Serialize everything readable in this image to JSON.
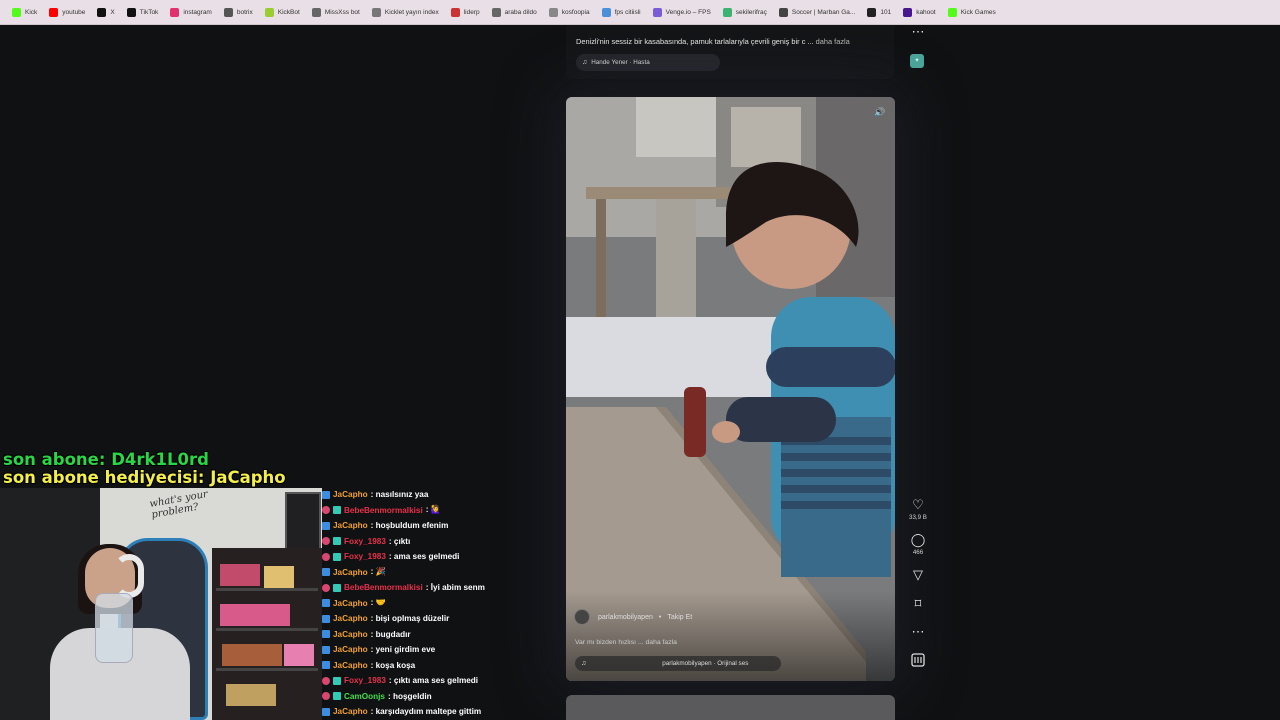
{
  "bookmarks": [
    {
      "label": "Kick",
      "color": "#53fc18"
    },
    {
      "label": "youtube",
      "color": "#ff0000"
    },
    {
      "label": "X",
      "color": "#111111"
    },
    {
      "label": "TikTok",
      "color": "#111111"
    },
    {
      "label": "instagram",
      "color": "#e1306c"
    },
    {
      "label": "botrix",
      "color": "#555555"
    },
    {
      "label": "KickBot",
      "color": "#9acd32"
    },
    {
      "label": "MissXss bot",
      "color": "#666666"
    },
    {
      "label": "Kicklet yayın index",
      "color": "#777777"
    },
    {
      "label": "liderp",
      "color": "#cc3333"
    },
    {
      "label": "araba dildo",
      "color": "#666666"
    },
    {
      "label": "kosfoopia",
      "color": "#888888"
    },
    {
      "label": "fps citiisli",
      "color": "#4a90d9"
    },
    {
      "label": "Venge.io – FPS",
      "color": "#7b5cd6"
    },
    {
      "label": "sekilerifraç",
      "color": "#3cb371"
    },
    {
      "label": "Soccer | Marban Ga...",
      "color": "#444444"
    },
    {
      "label": "101",
      "color": "#222222"
    },
    {
      "label": "kahoot",
      "color": "#46178f"
    },
    {
      "label": "Kick Games",
      "color": "#53fc18"
    }
  ],
  "previous_post": {
    "description": "Denizli'nin sessiz bir kasabasında, pamuk tarlalarıyla çevrili geniş bir c ...",
    "more_label": "daha fazla",
    "music": "Hande Yener · Hasta"
  },
  "current_post": {
    "author": "parlakmobilyapen",
    "follow_label": "Takip Et",
    "caption": "Var mı bizden hızlısı ...",
    "more_label": "daha fazla",
    "music": "parlakmobilyapen · Orijinal ses",
    "likes": "33,9 B",
    "comments": "466"
  },
  "actions": {
    "more_top": "⋯",
    "like": "♡",
    "comment": "◯",
    "share": "▽",
    "save": "⌑",
    "more": "⋯"
  },
  "overlay": {
    "last_sub": "son abone: D4rk1L0rd",
    "last_gifter": "son abone hediyecisi: JaCapho"
  },
  "webcam": {
    "wall_text": "what's your problem?"
  },
  "chat": [
    {
      "badges": [
        "blue"
      ],
      "user": "JaCapho",
      "color": "#f0a030",
      "text": ": nasılsınız yaa"
    },
    {
      "badges": [
        "pink",
        "teal"
      ],
      "user": "BebeBenmormalkisi",
      "color": "#e8304a",
      "text": ": 🙋‍♀️"
    },
    {
      "badges": [
        "blue"
      ],
      "user": "JaCapho",
      "color": "#f0a030",
      "text": ": hoşbuldum efenim"
    },
    {
      "badges": [
        "pink",
        "teal"
      ],
      "user": "Foxy_1983",
      "color": "#e8304a",
      "text": ": çıktı"
    },
    {
      "badges": [
        "pink",
        "teal"
      ],
      "user": "Foxy_1983",
      "color": "#e8304a",
      "text": ": ama ses gelmedi"
    },
    {
      "badges": [
        "blue"
      ],
      "user": "JaCapho",
      "color": "#f0a030",
      "text": ": 🎉"
    },
    {
      "badges": [
        "pink",
        "teal"
      ],
      "user": "BebeBenmormalkisi",
      "color": "#e8304a",
      "text": ": İyi abim senm"
    },
    {
      "badges": [
        "blue"
      ],
      "user": "JaCapho",
      "color": "#f0a030",
      "text": ": 🤝"
    },
    {
      "badges": [
        "blue"
      ],
      "user": "JaCapho",
      "color": "#f0a030",
      "text": ": bişi oplmaş düzelir"
    },
    {
      "badges": [
        "blue"
      ],
      "user": "JaCapho",
      "color": "#f0a030",
      "text": ": bugdadır"
    },
    {
      "badges": [
        "blue"
      ],
      "user": "JaCapho",
      "color": "#f0a030",
      "text": ": yeni girdim eve"
    },
    {
      "badges": [
        "blue"
      ],
      "user": "JaCapho",
      "color": "#f0a030",
      "text": ": koşa koşa"
    },
    {
      "badges": [
        "pink",
        "teal"
      ],
      "user": "Foxy_1983",
      "color": "#e8304a",
      "text": ": çıktı ama ses gelmedi"
    },
    {
      "badges": [
        "pink",
        "teal"
      ],
      "user": "CamOonjs",
      "color": "#3ee04a",
      "text": ": hoşgeldin"
    },
    {
      "badges": [
        "blue"
      ],
      "user": "JaCapho",
      "color": "#f0a030",
      "text": ": karşıdaydım maltepe gittim"
    }
  ]
}
